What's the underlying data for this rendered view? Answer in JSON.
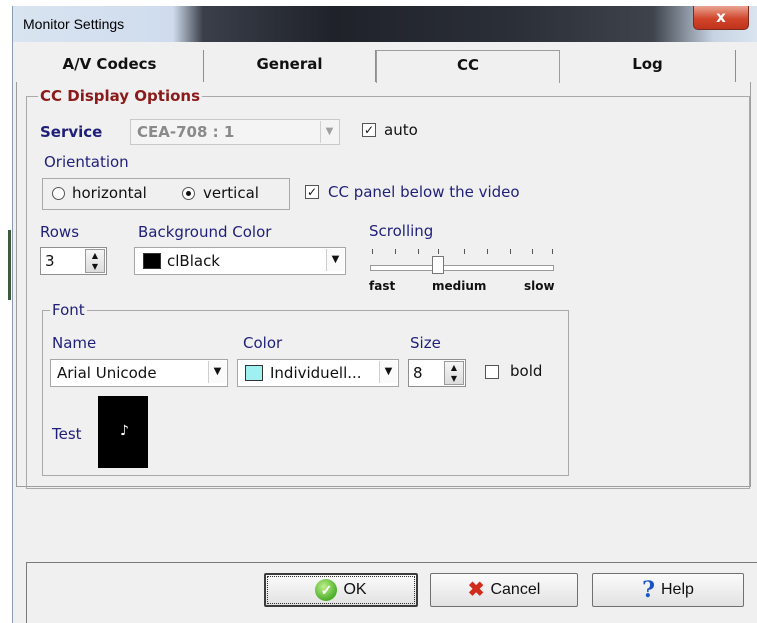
{
  "window": {
    "title": "Monitor Settings",
    "close_label": "x"
  },
  "tabs": [
    {
      "label": "A/V Codecs",
      "active": false
    },
    {
      "label": "General",
      "active": false
    },
    {
      "label": "CC",
      "active": true
    },
    {
      "label": "Log",
      "active": false
    }
  ],
  "cc": {
    "group_title": "CC Display Options",
    "service_label": "Service",
    "service_value": "CEA-708 : 1",
    "auto_label": "auto",
    "auto_checked": true,
    "orientation_label": "Orientation",
    "horizontal_label": "horizontal",
    "vertical_label": "vertical",
    "orientation_value": "vertical",
    "panel_below_label": "CC panel below the video",
    "panel_below_checked": true,
    "rows_label": "Rows",
    "rows_value": "3",
    "bg_color_label": "Background Color",
    "bg_color_value": "clBlack",
    "bg_color_swatch": "#000000",
    "scrolling_label": "Scrolling",
    "scroll_fast": "fast",
    "scroll_medium": "medium",
    "scroll_slow": "slow",
    "scroll_level": "medium"
  },
  "font": {
    "group_title": "Font",
    "name_label": "Name",
    "name_value": "Arial Unicode",
    "color_label": "Color",
    "color_value": "Individuell...",
    "color_swatch": "#9ff0f0",
    "size_label": "Size",
    "size_value": "8",
    "bold_label": "bold",
    "bold_checked": false,
    "test_label": "Test",
    "test_preview": "♪"
  },
  "buttons": {
    "ok": "OK",
    "cancel": "Cancel",
    "help": "Help"
  }
}
